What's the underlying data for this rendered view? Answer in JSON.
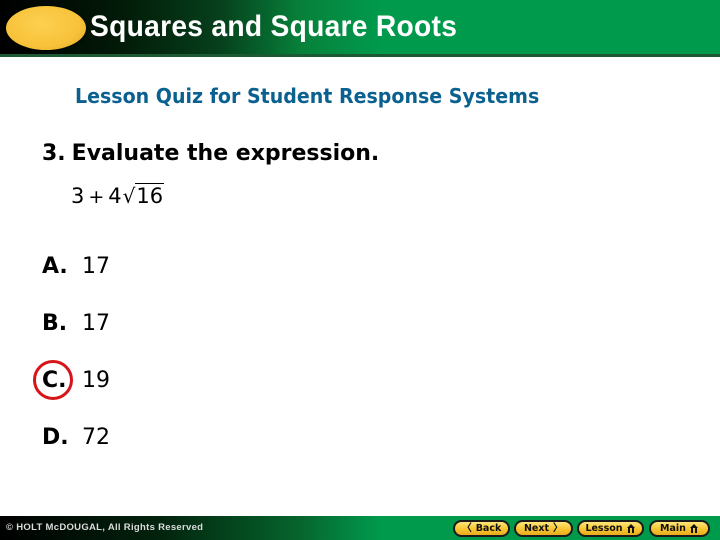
{
  "header": {
    "title": "Squares and Square Roots"
  },
  "subtitle": "Lesson Quiz for Student Response Systems",
  "question": {
    "number": "3.",
    "prompt": "Evaluate the expression.",
    "expression": {
      "term1": "3",
      "operator": "+",
      "coefficient": "4",
      "radical_sign": "√",
      "radicand": "16"
    }
  },
  "choices": [
    {
      "letter": "A.",
      "value": "17",
      "selected": false
    },
    {
      "letter": "B.",
      "value": "17",
      "selected": false
    },
    {
      "letter": "C.",
      "value": "19",
      "selected": true
    },
    {
      "letter": "D.",
      "value": "72",
      "selected": false
    }
  ],
  "answer_marker": {
    "choice": "C",
    "color": "#d8141b"
  },
  "footer": {
    "copyright": "© HOLT McDOUGAL, All Rights Reserved",
    "nav": {
      "back": {
        "label": "Back",
        "icon": "chevron-left-icon",
        "glyph": "〈"
      },
      "next": {
        "label": "Next",
        "icon": "chevron-right-icon",
        "glyph": "〉"
      },
      "lesson": {
        "label": "Lesson",
        "icon": "home-icon"
      },
      "main": {
        "label": "Main",
        "icon": "home-icon"
      }
    }
  },
  "colors": {
    "header_green": "#009a4d",
    "subtitle_blue": "#0a6190",
    "button_yellow": "#f7c531",
    "oval_yellow": "#f8c23a"
  }
}
